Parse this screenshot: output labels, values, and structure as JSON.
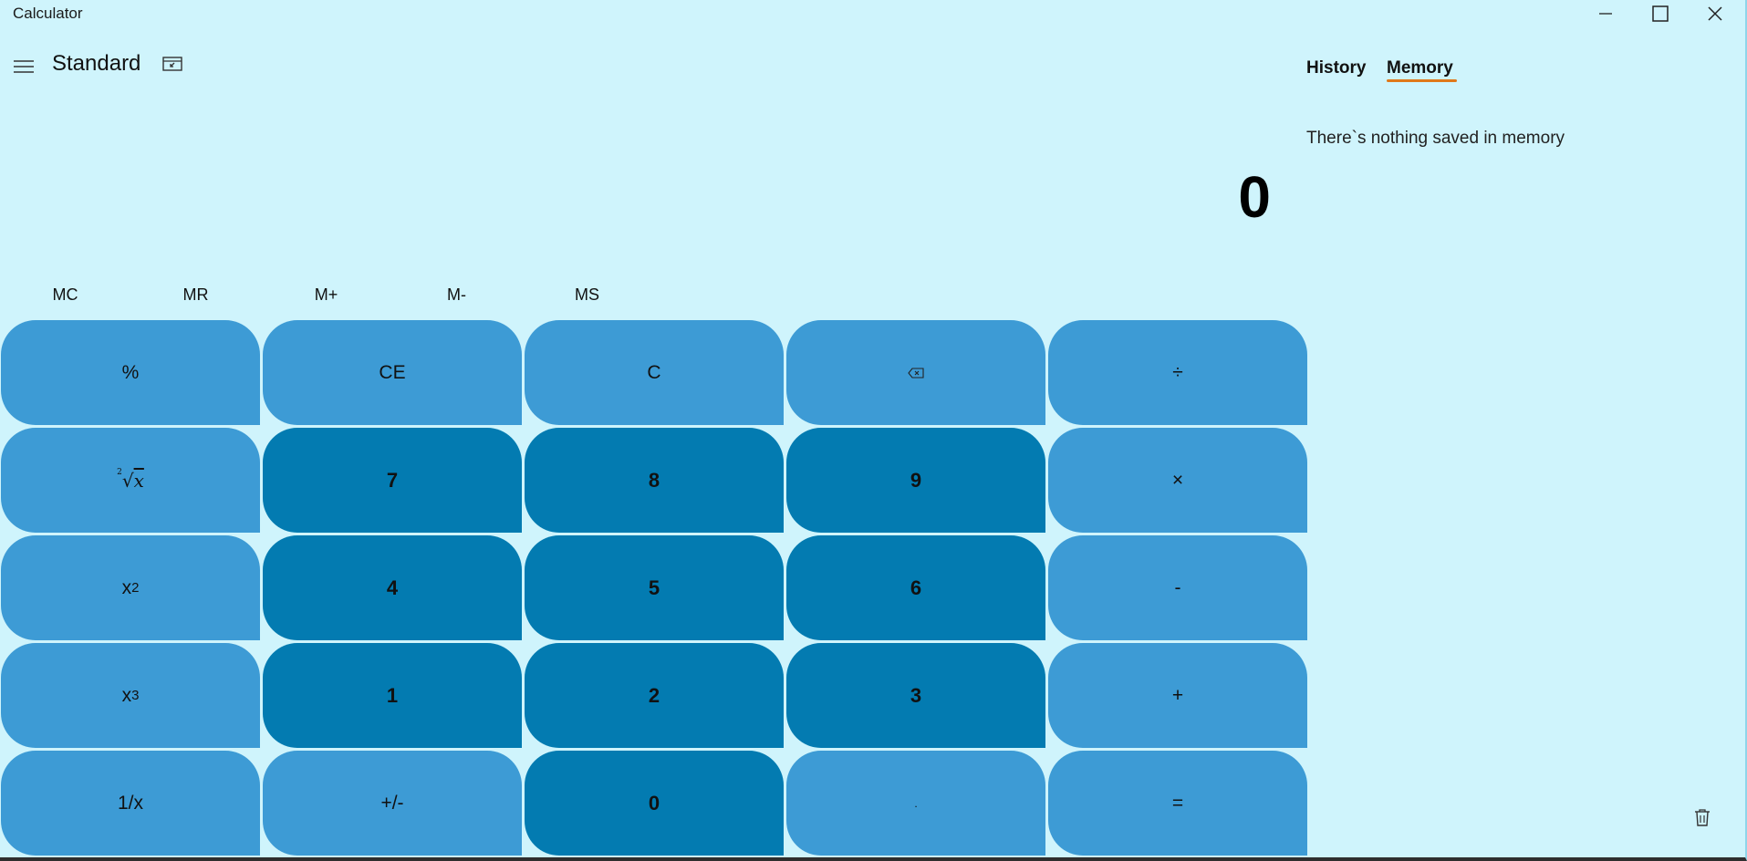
{
  "window": {
    "title": "Calculator",
    "controls": {
      "minimize": "minimize-icon",
      "maximize": "maximize-icon",
      "close": "close-icon"
    }
  },
  "header": {
    "mode": "Standard",
    "menu_icon": "hamburger-icon",
    "keep_on_top_icon": "keep-on-top-icon"
  },
  "display": {
    "value": "0"
  },
  "memory_buttons": [
    "MC",
    "MR",
    "M+",
    "M-",
    "MS"
  ],
  "keypad": [
    [
      {
        "label": "%",
        "style": "light"
      },
      {
        "label": "CE",
        "style": "light"
      },
      {
        "label": "C",
        "style": "light"
      },
      {
        "label": "⌫",
        "style": "light",
        "icon": "backspace-icon"
      },
      {
        "label": "÷",
        "style": "light"
      }
    ],
    [
      {
        "label": "²√x",
        "style": "light"
      },
      {
        "label": "7",
        "style": "dark"
      },
      {
        "label": "8",
        "style": "dark"
      },
      {
        "label": "9",
        "style": "dark"
      },
      {
        "label": "×",
        "style": "light"
      }
    ],
    [
      {
        "label": "x2",
        "style": "light"
      },
      {
        "label": "4",
        "style": "dark"
      },
      {
        "label": "5",
        "style": "dark"
      },
      {
        "label": "6",
        "style": "dark"
      },
      {
        "label": "-",
        "style": "light"
      }
    ],
    [
      {
        "label": "x3",
        "style": "light"
      },
      {
        "label": "1",
        "style": "dark"
      },
      {
        "label": "2",
        "style": "dark"
      },
      {
        "label": "3",
        "style": "dark"
      },
      {
        "label": "+",
        "style": "light"
      }
    ],
    [
      {
        "label": "1/x",
        "style": "light"
      },
      {
        "label": "+/-",
        "style": "light"
      },
      {
        "label": "0",
        "style": "dark"
      },
      {
        "label": ".",
        "style": "light"
      },
      {
        "label": "=",
        "style": "light"
      }
    ]
  ],
  "side_panel": {
    "tabs": [
      {
        "label": "History",
        "active": false
      },
      {
        "label": "Memory",
        "active": true
      }
    ],
    "message": "There`s nothing saved in memory",
    "clear_icon": "trash-icon"
  },
  "colors": {
    "background": "#cff4fc",
    "key_light": "#3d9bd5",
    "key_dark": "#037bb1",
    "tab_accent": "#e0781a"
  }
}
